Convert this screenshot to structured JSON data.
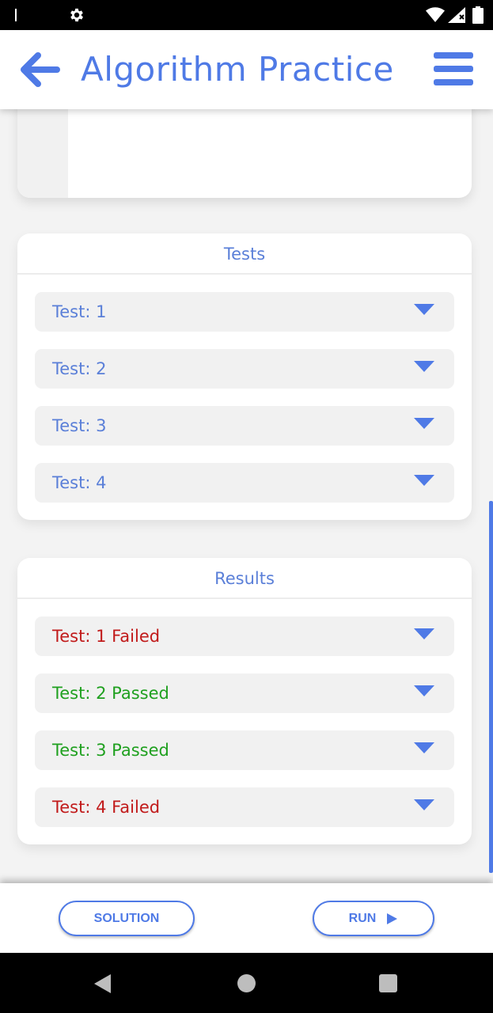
{
  "app": {
    "title": "Algorithm Practice"
  },
  "colors": {
    "accent": "#4f7ae6",
    "label_blue": "#5a7fd8",
    "failed": "#c11a1a",
    "passed": "#1fa01f"
  },
  "tests": {
    "title": "Tests",
    "items": [
      {
        "label": "Test: 1"
      },
      {
        "label": "Test: 2"
      },
      {
        "label": "Test: 3"
      },
      {
        "label": "Test: 4"
      }
    ]
  },
  "results": {
    "title": "Results",
    "items": [
      {
        "label": "Test: 1 Failed",
        "status": "failed"
      },
      {
        "label": "Test: 2 Passed",
        "status": "passed"
      },
      {
        "label": "Test: 3 Passed",
        "status": "passed"
      },
      {
        "label": "Test: 4 Failed",
        "status": "failed"
      }
    ]
  },
  "actions": {
    "solution_label": "SOLUTION",
    "run_label": "RUN"
  },
  "icons": {
    "status_settings": "gear-icon",
    "status_wifi": "wifi-icon",
    "status_signal": "signal-icon",
    "status_battery": "battery-icon",
    "back": "arrow-left-icon",
    "menu": "hamburger-menu-icon",
    "expand": "caret-down-icon",
    "run": "play-icon",
    "nav_back": "triangle-back-icon",
    "nav_home": "circle-home-icon",
    "nav_recents": "square-recents-icon"
  }
}
